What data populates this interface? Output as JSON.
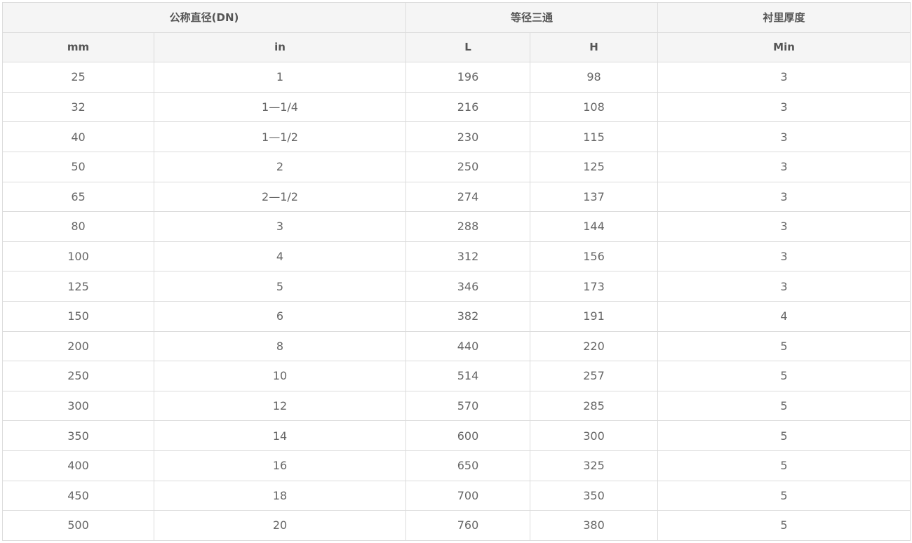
{
  "table": {
    "group_headers": [
      "公称直径(DN)",
      "等径三通",
      "衬里厚度"
    ],
    "sub_headers": [
      "mm",
      "in",
      "L",
      "H",
      "Min"
    ],
    "rows": [
      [
        "25",
        "1",
        "196",
        "98",
        "3"
      ],
      [
        "32",
        "1—1/4",
        "216",
        "108",
        "3"
      ],
      [
        "40",
        "1—1/2",
        "230",
        "115",
        "3"
      ],
      [
        "50",
        "2",
        "250",
        "125",
        "3"
      ],
      [
        "65",
        "2—1/2",
        "274",
        "137",
        "3"
      ],
      [
        "80",
        "3",
        "288",
        "144",
        "3"
      ],
      [
        "100",
        "4",
        "312",
        "156",
        "3"
      ],
      [
        "125",
        "5",
        "346",
        "173",
        "3"
      ],
      [
        "150",
        "6",
        "382",
        "191",
        "4"
      ],
      [
        "200",
        "8",
        "440",
        "220",
        "5"
      ],
      [
        "250",
        "10",
        "514",
        "257",
        "5"
      ],
      [
        "300",
        "12",
        "570",
        "285",
        "5"
      ],
      [
        "350",
        "14",
        "600",
        "300",
        "5"
      ],
      [
        "400",
        "16",
        "650",
        "325",
        "5"
      ],
      [
        "450",
        "18",
        "700",
        "350",
        "5"
      ],
      [
        "500",
        "20",
        "760",
        "380",
        "5"
      ]
    ]
  }
}
